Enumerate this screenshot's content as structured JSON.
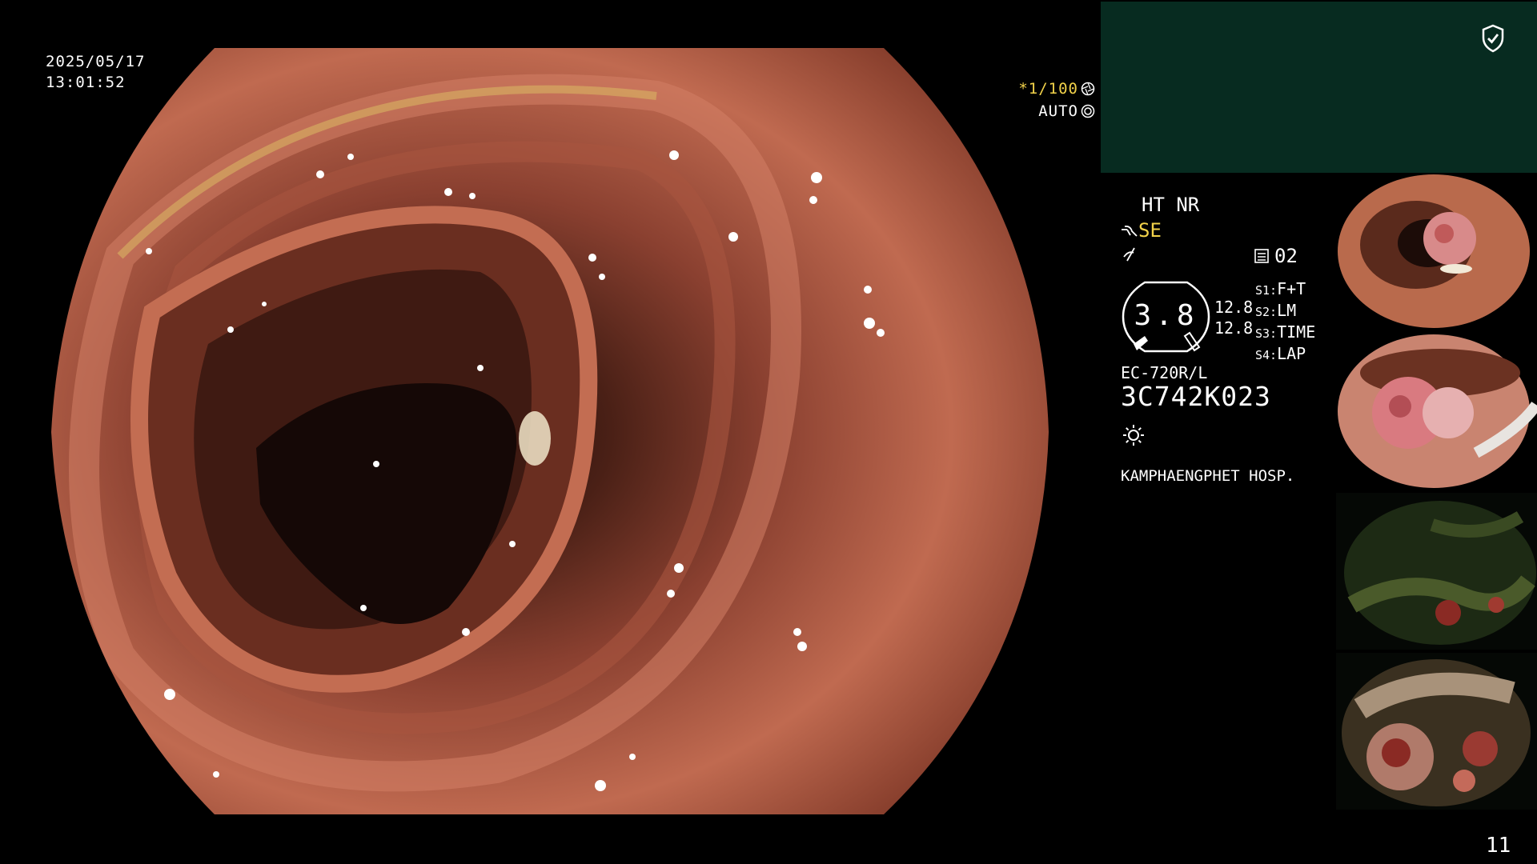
{
  "overlay": {
    "date": "2025/05/17",
    "time": "13:01:52",
    "shutter": "*1/100",
    "iris": "AUTO"
  },
  "panel": {
    "enhance": "HT NR",
    "mode": "SE",
    "structure": "02",
    "gauge_value": "3.8",
    "sub_value_1": "12.8",
    "sub_value_2": "12.8",
    "s_keys": [
      "S1:",
      "S2:",
      "S3:",
      "S4:"
    ],
    "s_values": [
      "F+T",
      "LM",
      "TIME",
      "LAP"
    ],
    "scope_model": "EC-720R/L",
    "serial": "3C742K023",
    "hospital": "KAMPHAENGPHET HOSP.",
    "page_number": "11"
  },
  "icons": [
    "shield-check-icon",
    "aperture-icon",
    "iris-icon",
    "scope-icon",
    "edge-icon",
    "memory-icon",
    "light-icon"
  ],
  "colors": {
    "top_panel": "#072b20",
    "highlight_text": "#f2d24a",
    "tissue": "#b5604a"
  }
}
